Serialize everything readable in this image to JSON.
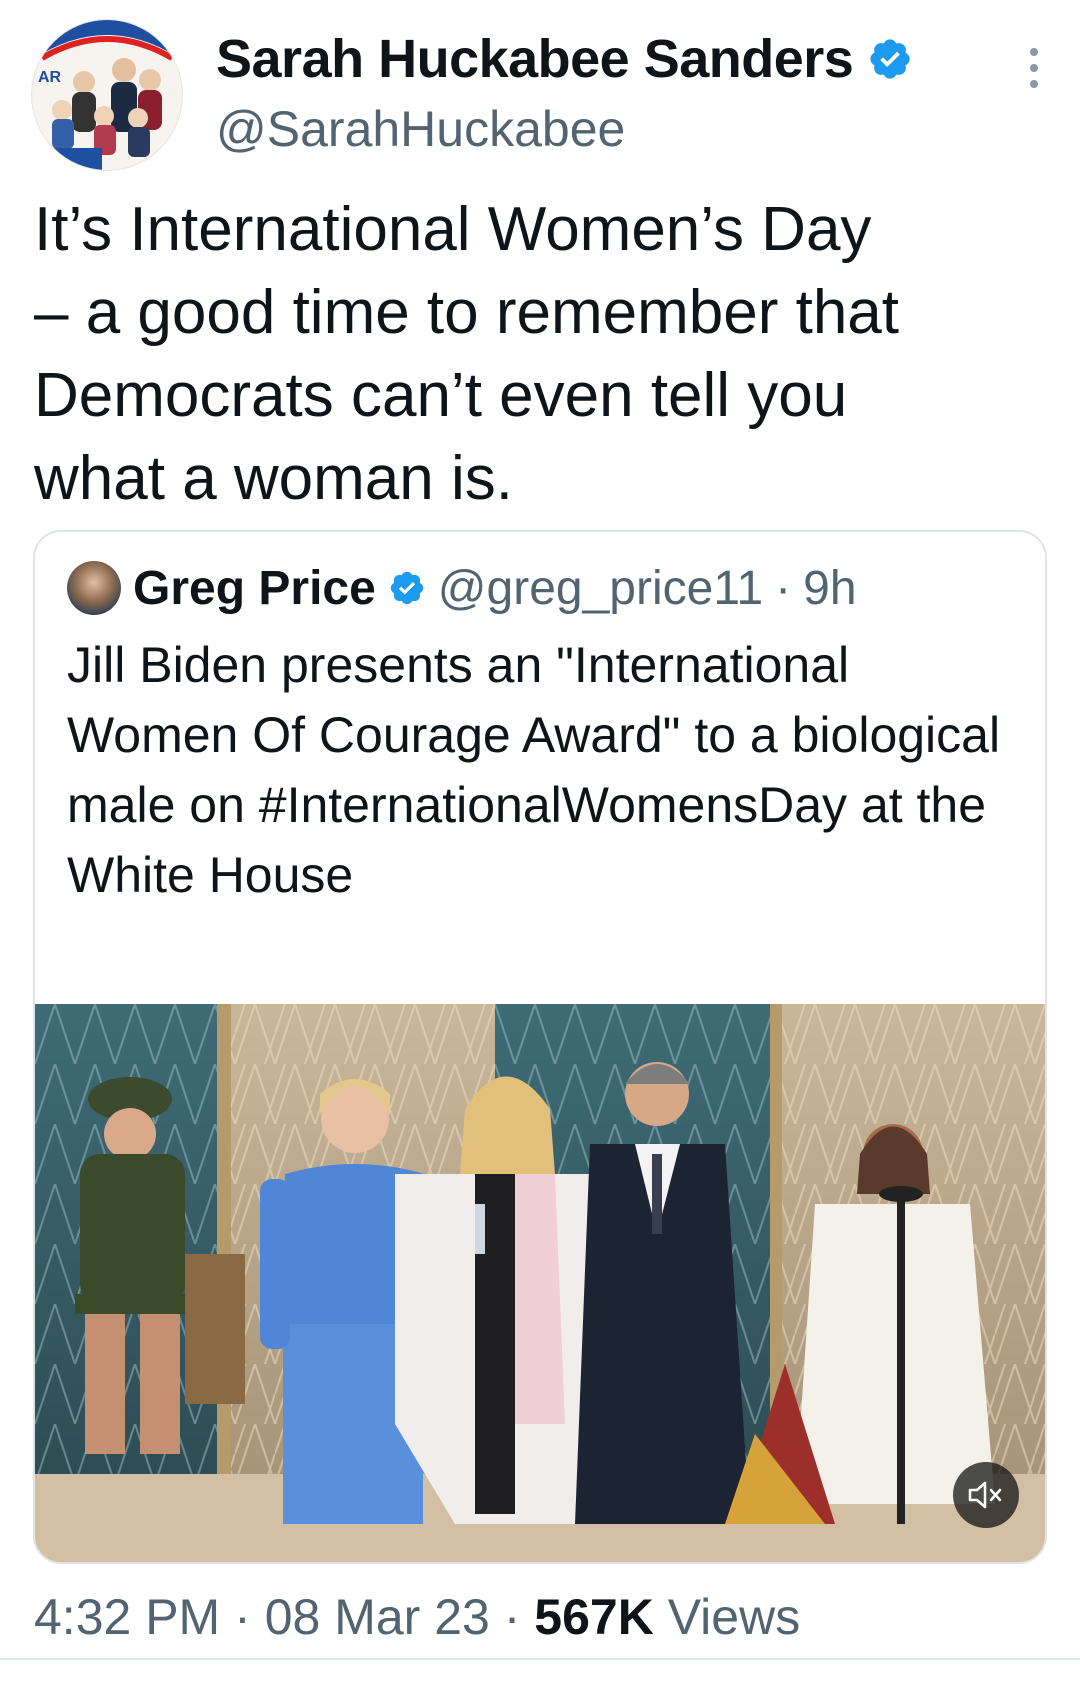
{
  "tweet": {
    "author_name": "Sarah Huckabee Sanders",
    "author_handle": "@SarahHuckabee",
    "verified": true,
    "text": "It’s International Women’s Day\n– a good time to remember that\nDemocrats can’t even tell you\nwhat a woman is.",
    "avatar_text": "AR",
    "time": "4:32 PM",
    "date": "08 Mar 23",
    "separator": "·",
    "views_count": "567K",
    "views_label": "Views"
  },
  "quoted_tweet": {
    "author_name": "Greg Price",
    "author_handle": "@greg_price11",
    "separator": "·",
    "age": "9h",
    "verified": true,
    "text": "Jill Biden presents an \"International Women Of Courage Award\" to a biological male on #InternationalWomensDay at the White House"
  },
  "colors": {
    "verified_blue": "#1d9bf0",
    "secondary_text": "#536471",
    "primary_text": "#0f1419"
  },
  "icons": {
    "verified": "verified-badge-icon",
    "more": "more-options-icon",
    "mute": "muted-speaker-icon"
  }
}
